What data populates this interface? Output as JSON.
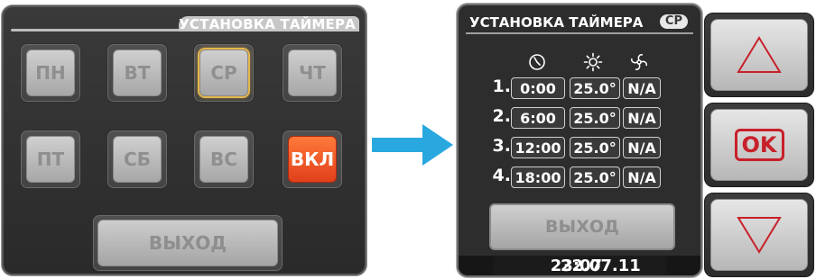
{
  "left_panel": {
    "title": "УСТАНОВКА ТАЙМЕРА",
    "days": [
      "ПН",
      "ВТ",
      "СР",
      "ЧТ",
      "ПТ",
      "СБ",
      "ВС"
    ],
    "selected_day": "СР",
    "enable_label": "ВКЛ",
    "exit_label": "ВЫХОД"
  },
  "right_panel": {
    "title": "УСТАНОВКА ТАЙМЕРА",
    "day_badge": "СР",
    "column_icons": [
      "clock-icon",
      "sun-icon",
      "fan-icon"
    ],
    "schedule": [
      {
        "num": "1.",
        "time": "0:00",
        "temp": "25.0°",
        "mode": "N/A"
      },
      {
        "num": "2.",
        "time": "6:00",
        "temp": "25.0°",
        "mode": "N/A"
      },
      {
        "num": "3.",
        "time": "12:00",
        "temp": "25.0°",
        "mode": "N/A"
      },
      {
        "num": "4.",
        "time": "18:00",
        "temp": "25.0°",
        "mode": "N/A"
      }
    ],
    "exit_label": "ВЫХОД",
    "status": {
      "date": "22.07.11",
      "time": "23:07"
    }
  },
  "side_buttons": {
    "up_icon": "triangle-up-icon",
    "ok_label": "OK",
    "down_icon": "triangle-down-icon"
  },
  "colors": {
    "accent_orange": "#e8502a",
    "selected_outline": "#e5b64a",
    "ok_red": "#c8202a",
    "arrow_blue": "#29a8e0"
  }
}
